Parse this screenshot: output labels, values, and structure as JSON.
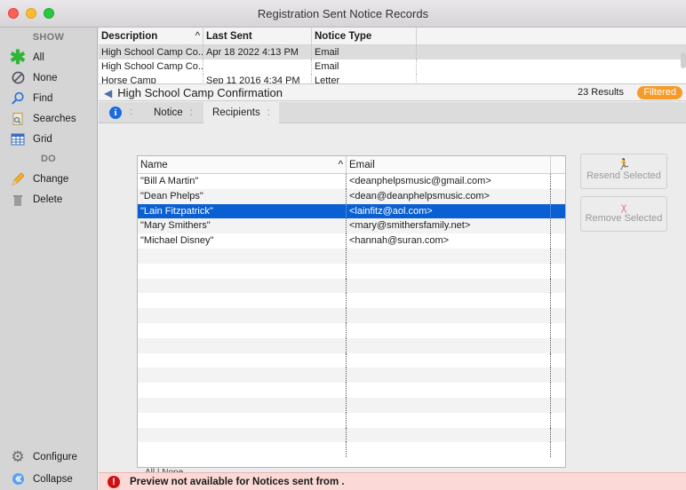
{
  "window": {
    "title": "Registration Sent Notice Records"
  },
  "sidebar": {
    "show_header": "SHOW",
    "show_items": [
      {
        "label": "All",
        "icon": "asterisk-icon"
      },
      {
        "label": "None",
        "icon": "none-icon"
      },
      {
        "label": "Find",
        "icon": "magnifier-icon"
      },
      {
        "label": "Searches",
        "icon": "searches-icon"
      },
      {
        "label": "Grid",
        "icon": "grid-icon"
      }
    ],
    "do_header": "DO",
    "do_items": [
      {
        "label": "Change",
        "icon": "pencil-icon"
      },
      {
        "label": "Delete",
        "icon": "trash-icon"
      }
    ],
    "bottom_items": [
      {
        "label": "Configure",
        "icon": "gear-icon"
      },
      {
        "label": "Collapse",
        "icon": "collapse-icon"
      }
    ]
  },
  "records": {
    "columns": [
      "Description",
      "Last Sent",
      "Notice Type"
    ],
    "sort_indicator": "^",
    "rows": [
      {
        "description": "High School Camp Co...",
        "last_sent": "Apr 18 2022 4:13 PM",
        "notice_type": "Email"
      },
      {
        "description": "High School Camp Co...",
        "last_sent": "",
        "notice_type": "Email"
      },
      {
        "description": "Horse Camp",
        "last_sent": "Sep 11 2016 4:34 PM",
        "notice_type": "Letter"
      }
    ]
  },
  "detail": {
    "title": "High School Camp Confirmation",
    "results": "23 Results",
    "filter_badge": "Filtered"
  },
  "tabs": [
    {
      "label": "Notice"
    },
    {
      "label": "Recipients"
    }
  ],
  "tab_sep": ":",
  "recipients": {
    "columns": {
      "name": "Name",
      "email": "Email",
      "sort": "^"
    },
    "rows": [
      {
        "name": "\"Bill A Martin\"",
        "email": "<deanphelpsmusic@gmail.com>"
      },
      {
        "name": "\"Dean Phelps\"",
        "email": "<dean@deanphelpsmusic.com>"
      },
      {
        "name": "\"Lain Fitzpatrick\"",
        "email": "<lainfitz@aol.com>"
      },
      {
        "name": "\"Mary  Smithers\"",
        "email": "<mary@smithersfamily.net>"
      },
      {
        "name": "\"Michael Disney\"",
        "email": "<hannah@suran.com>"
      }
    ],
    "selected_index": 2,
    "empty_rows": 14
  },
  "actions": {
    "resend": "Resend Selected",
    "remove": "Remove Selected"
  },
  "allnone": "All  |  None",
  "status": {
    "message": "Preview not available for Notices sent from ."
  },
  "colors": {
    "selection": "#0a5fd3",
    "filtered_badge": "#f79a2a",
    "error": "#d20f0f",
    "status_bg": "#fbd9d6"
  }
}
